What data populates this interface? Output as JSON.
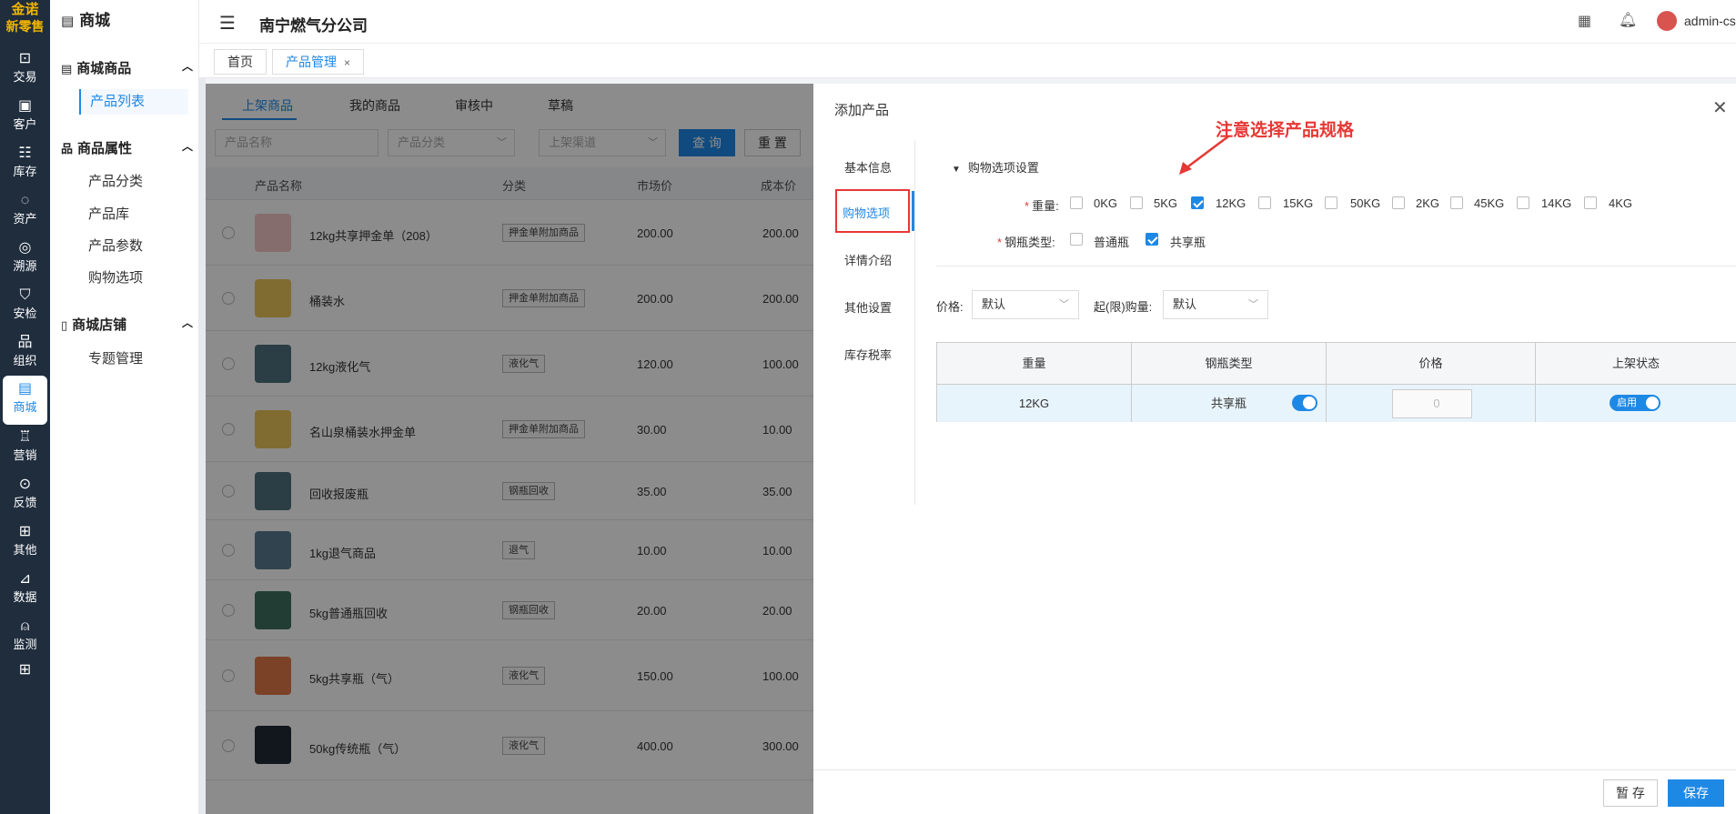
{
  "brand": {
    "line1": "金诺",
    "line2": "新零售"
  },
  "rail": [
    {
      "icon": "bag-icon",
      "glyph": "⊡",
      "label": "交易"
    },
    {
      "icon": "id-card-icon",
      "glyph": "▣",
      "label": "客户"
    },
    {
      "icon": "inventory-icon",
      "glyph": "☷",
      "label": "库存"
    },
    {
      "icon": "bulb-icon",
      "glyph": "◌",
      "label": "资产"
    },
    {
      "icon": "compass-icon",
      "glyph": "◎",
      "label": "溯源"
    },
    {
      "icon": "shield-icon",
      "glyph": "⛉",
      "label": "安检"
    },
    {
      "icon": "org-icon",
      "glyph": "品",
      "label": "组织"
    },
    {
      "icon": "store-icon",
      "glyph": "▤",
      "label": "商城"
    },
    {
      "icon": "trophy-icon",
      "glyph": "♖",
      "label": "营销"
    },
    {
      "icon": "chat-icon",
      "glyph": "⊙",
      "label": "反馈"
    },
    {
      "icon": "apps-icon",
      "glyph": "⊞",
      "label": "其他"
    },
    {
      "icon": "chart-icon",
      "glyph": "⊿",
      "label": "数据"
    },
    {
      "icon": "alarm-icon",
      "glyph": "⍝",
      "label": "监测"
    },
    {
      "icon": "grid-icon",
      "glyph": "⊞",
      "label": ""
    }
  ],
  "subnav": {
    "title": "商城",
    "groups": [
      {
        "label": "商城商品",
        "items": [
          "产品列表"
        ]
      },
      {
        "label": "商品属性",
        "items": [
          "产品分类",
          "产品库",
          "产品参数",
          "购物选项"
        ]
      },
      {
        "label": "商城店铺",
        "items": [
          "专题管理"
        ]
      }
    ]
  },
  "header": {
    "company": "南宁燃气分公司",
    "user": "admin-cs"
  },
  "tabs": {
    "home": "首页",
    "active": "产品管理",
    "close": "×"
  },
  "list": {
    "subtabs": [
      "上架商品",
      "我的商品",
      "审核中",
      "草稿"
    ],
    "filters": {
      "name_ph": "产品名称",
      "category_ph": "产品分类",
      "channel_ph": "上架渠道"
    },
    "query": "查 询",
    "reset": "重 置",
    "columns": [
      "产品名称",
      "分类",
      "市场价",
      "成本价"
    ],
    "rows": [
      {
        "name": "12kg共享押金单（208）",
        "tag": "押金单附加商品",
        "mkt": "200.00",
        "cost": "200.00"
      },
      {
        "name": "桶装水",
        "tag": "押金单附加商品",
        "mkt": "200.00",
        "cost": "200.00"
      },
      {
        "name": "12kg液化气",
        "tag": "液化气",
        "mkt": "120.00",
        "cost": "100.00"
      },
      {
        "name": "名山泉桶装水押金单",
        "tag": "押金单附加商品",
        "mkt": "30.00",
        "cost": "10.00"
      },
      {
        "name": "回收报废瓶",
        "tag": "钢瓶回收",
        "mkt": "35.00",
        "cost": "35.00"
      },
      {
        "name": "1kg退气商品",
        "tag": "退气",
        "mkt": "10.00",
        "cost": "10.00"
      },
      {
        "name": "5kg普通瓶回收",
        "tag": "钢瓶回收",
        "mkt": "20.00",
        "cost": "20.00"
      },
      {
        "name": "5kg共享瓶（气）",
        "tag": "液化气",
        "mkt": "150.00",
        "cost": "100.00"
      },
      {
        "name": "50kg传统瓶（气）",
        "tag": "液化气",
        "mkt": "400.00",
        "cost": "300.00"
      }
    ]
  },
  "drawer": {
    "title": "添加产品",
    "nav": [
      "基本信息",
      "购物选项",
      "详情介绍",
      "其他设置",
      "库存税率"
    ],
    "section": "购物选项设置",
    "annotation": "注意选择产品规格",
    "weight_label": "重量:",
    "weights": [
      {
        "label": "0KG",
        "checked": false
      },
      {
        "label": "5KG",
        "checked": false
      },
      {
        "label": "12KG",
        "checked": true
      },
      {
        "label": "15KG",
        "checked": false
      },
      {
        "label": "50KG",
        "checked": false
      },
      {
        "label": "2KG",
        "checked": false
      },
      {
        "label": "45KG",
        "checked": false
      },
      {
        "label": "14KG",
        "checked": false
      },
      {
        "label": "4KG",
        "checked": false
      }
    ],
    "bottle_label": "钢瓶类型:",
    "bottles": [
      {
        "label": "普通瓶",
        "checked": false
      },
      {
        "label": "共享瓶",
        "checked": true
      }
    ],
    "price_label": "价格:",
    "price_value": "默认",
    "limit_label": "起(限)购量:",
    "limit_value": "默认",
    "grid": {
      "headers": [
        "重量",
        "钢瓶类型",
        "价格",
        "上架状态"
      ],
      "row": {
        "weight": "12KG",
        "bottle": "共享瓶",
        "price_ph": "0",
        "status": "启用"
      }
    },
    "draft": "暂 存",
    "save": "保存"
  }
}
